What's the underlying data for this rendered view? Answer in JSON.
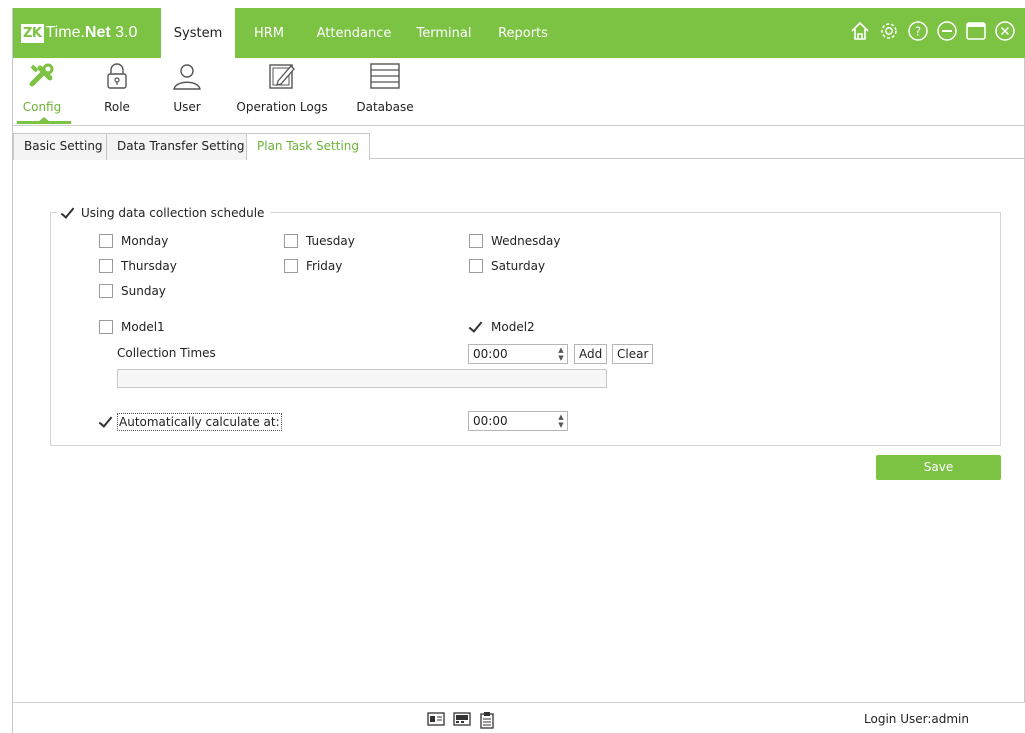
{
  "app": {
    "logo_mark": "ZK",
    "logo_time": "Time.",
    "logo_net": "Net",
    "logo_version": " 3.0"
  },
  "menu": {
    "items": [
      {
        "label": "System",
        "active": true
      },
      {
        "label": "HRM",
        "active": false
      },
      {
        "label": "Attendance",
        "active": false
      },
      {
        "label": "Terminal",
        "active": false
      },
      {
        "label": "Reports",
        "active": false
      }
    ]
  },
  "window_icons": [
    "home-icon",
    "settings-icon",
    "help-icon",
    "minimize-icon",
    "maximize-icon",
    "close-icon"
  ],
  "toolbar": {
    "items": [
      {
        "label": "Config",
        "icon": "tools-icon",
        "active": true
      },
      {
        "label": "Role",
        "icon": "lock-icon",
        "active": false
      },
      {
        "label": "User",
        "icon": "user-icon",
        "active": false
      },
      {
        "label": "Operation Logs",
        "icon": "edit-log-icon",
        "active": false
      },
      {
        "label": "Database",
        "icon": "database-icon",
        "active": false
      }
    ]
  },
  "subtabs": {
    "items": [
      {
        "label": "Basic Setting",
        "active": false
      },
      {
        "label": "Data Transfer Setting",
        "active": false
      },
      {
        "label": "Plan Task Setting",
        "active": true
      }
    ]
  },
  "schedule": {
    "use_schedule_label": "Using data collection schedule",
    "use_schedule_checked": true,
    "days": {
      "monday": {
        "label": "Monday",
        "checked": false
      },
      "tuesday": {
        "label": "Tuesday",
        "checked": false
      },
      "wednesday": {
        "label": "Wednesday",
        "checked": false
      },
      "thursday": {
        "label": "Thursday",
        "checked": false
      },
      "friday": {
        "label": "Friday",
        "checked": false
      },
      "saturday": {
        "label": "Saturday",
        "checked": false
      },
      "sunday": {
        "label": "Sunday",
        "checked": false
      }
    },
    "model1": {
      "label": "Model1",
      "checked": false
    },
    "model2": {
      "label": "Model2",
      "checked": true
    },
    "collection_times_label": "Collection Times",
    "collection_time_value": "00:00",
    "add_label": "Add",
    "clear_label": "Clear",
    "auto_calc": {
      "label": "Automatically calculate at:",
      "checked": true,
      "value": "00:00"
    }
  },
  "save_label": "Save",
  "status": {
    "icons": [
      "id-card-icon",
      "device-icon",
      "clipboard-icon"
    ],
    "login_text": "Login User:admin"
  },
  "colors": {
    "accent": "#7cc243",
    "active_text": "#6cb336"
  }
}
